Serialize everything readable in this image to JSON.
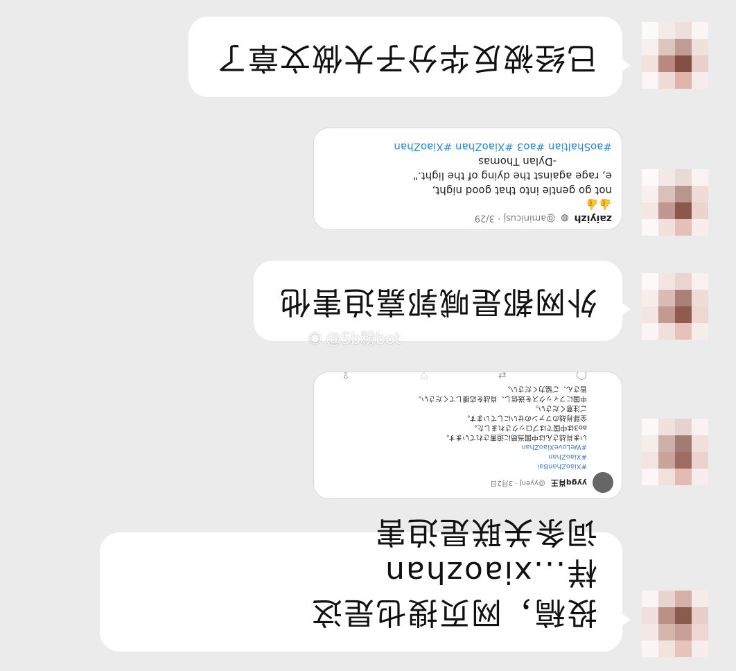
{
  "messages": [
    {
      "text": "已经被反华分子大做文章了"
    },
    {
      "tweet": {
        "lines": [
          "#aoShaltian #ao3 #XiaoZhan #XiaoZhan",
          "e, rage against the dying of the light.\"",
          "not go gentle into that good night,",
          "-Dylan Thomas"
        ],
        "name": "zaiyizh",
        "handle": "@aminicusj · 3/29"
      }
    },
    {
      "text": "外网都是喊郭嘉迫害他"
    },
    {
      "tweet": {
        "name": "yygq肖王",
        "handle": "@yyenJ · 3月2日",
        "tags": [
          "#XiaoZhanBai",
          "#XiaoZhan",
          "#WeLoveXiaoZhan"
        ],
        "lines": [
          "いま肖战さんは中国当局に迫害されています。",
          "ao3は中国ではブロックされました。",
          "全部肖战のファンのせいにしています。",
          "ご注意ください。",
          "中国にフィックスを送信し、肖战を応援してください。",
          "皆さん、ご協力ください。"
        ]
      }
    },
    {
      "text": "投稿，网页搜也是这样...xiaozhan\n词条关联是迫害"
    }
  ],
  "watermark": {
    "logo": "◉",
    "text": "@Sb粉bot"
  },
  "colors": {
    "background": "#ebebeb",
    "bubble": "#ffffff",
    "link": "#2b89d9"
  }
}
